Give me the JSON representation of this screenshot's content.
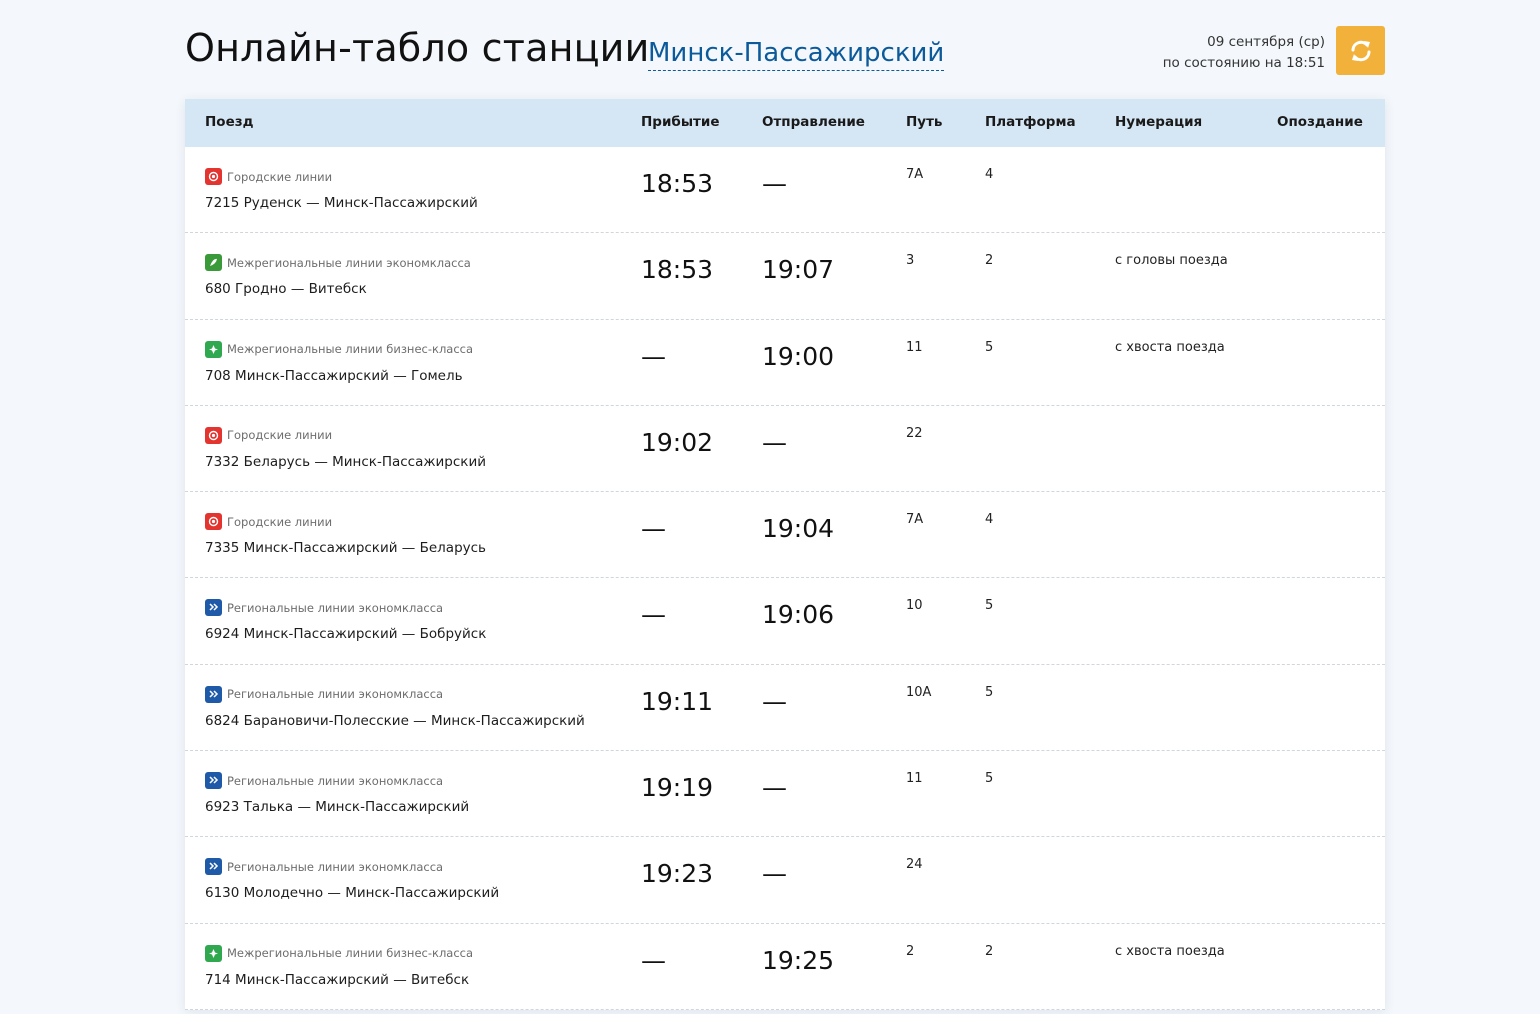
{
  "header": {
    "title": "Онлайн-табло станции",
    "station": "Минск-Пассажирский",
    "date": "09 сентября (ср)",
    "status": "по состоянию на 18:51",
    "refresh_icon": "refresh-icon"
  },
  "columns": {
    "train": "Поезд",
    "arrival": "Прибытие",
    "departure": "Отправление",
    "track": "Путь",
    "platform": "Платформа",
    "numbering": "Нумерация",
    "delay": "Опоздание"
  },
  "colors": {
    "city": "#e3342f",
    "interregional_econ": "#3a9a3a",
    "interregional_business": "#2fa84f",
    "regional_econ": "#1e5aa8",
    "accent": "#f2b13a",
    "link": "#0d5a9a"
  },
  "rows": [
    {
      "category": "Городские линии",
      "type": "city",
      "route": "7215 Руденск — Минск-Пассажирский",
      "arrival": "18:53",
      "departure": "—",
      "track": "7А",
      "platform": "4",
      "numbering": "",
      "delay": ""
    },
    {
      "category": "Межрегиональные линии экономкласса",
      "type": "interregional_econ",
      "route": "680 Гродно — Витебск",
      "arrival": "18:53",
      "departure": "19:07",
      "track": "3",
      "platform": "2",
      "numbering": "с головы поезда",
      "delay": ""
    },
    {
      "category": "Межрегиональные линии бизнес-класса",
      "type": "interregional_business",
      "route": "708 Минск-Пассажирский — Гомель",
      "arrival": "—",
      "departure": "19:00",
      "track": "11",
      "platform": "5",
      "numbering": "с хвоста поезда",
      "delay": ""
    },
    {
      "category": "Городские линии",
      "type": "city",
      "route": "7332 Беларусь — Минск-Пассажирский",
      "arrival": "19:02",
      "departure": "—",
      "track": "22",
      "platform": "",
      "numbering": "",
      "delay": ""
    },
    {
      "category": "Городские линии",
      "type": "city",
      "route": "7335 Минск-Пассажирский — Беларусь",
      "arrival": "—",
      "departure": "19:04",
      "track": "7А",
      "platform": "4",
      "numbering": "",
      "delay": ""
    },
    {
      "category": "Региональные линии экономкласса",
      "type": "regional_econ",
      "route": "6924 Минск-Пассажирский — Бобруйск",
      "arrival": "—",
      "departure": "19:06",
      "track": "10",
      "platform": "5",
      "numbering": "",
      "delay": ""
    },
    {
      "category": "Региональные линии экономкласса",
      "type": "regional_econ",
      "route": "6824 Барановичи-Полесские — Минск-Пассажирский",
      "arrival": "19:11",
      "departure": "—",
      "track": "10А",
      "platform": "5",
      "numbering": "",
      "delay": ""
    },
    {
      "category": "Региональные линии экономкласса",
      "type": "regional_econ",
      "route": "6923 Талька — Минск-Пассажирский",
      "arrival": "19:19",
      "departure": "—",
      "track": "11",
      "platform": "5",
      "numbering": "",
      "delay": ""
    },
    {
      "category": "Региональные линии экономкласса",
      "type": "regional_econ",
      "route": "6130 Молодечно — Минск-Пассажирский",
      "arrival": "19:23",
      "departure": "—",
      "track": "24",
      "platform": "",
      "numbering": "",
      "delay": ""
    },
    {
      "category": "Межрегиональные линии бизнес-класса",
      "type": "interregional_business",
      "route": "714 Минск-Пассажирский — Витебск",
      "arrival": "—",
      "departure": "19:25",
      "track": "2",
      "platform": "2",
      "numbering": "с хвоста поезда",
      "delay": ""
    }
  ]
}
